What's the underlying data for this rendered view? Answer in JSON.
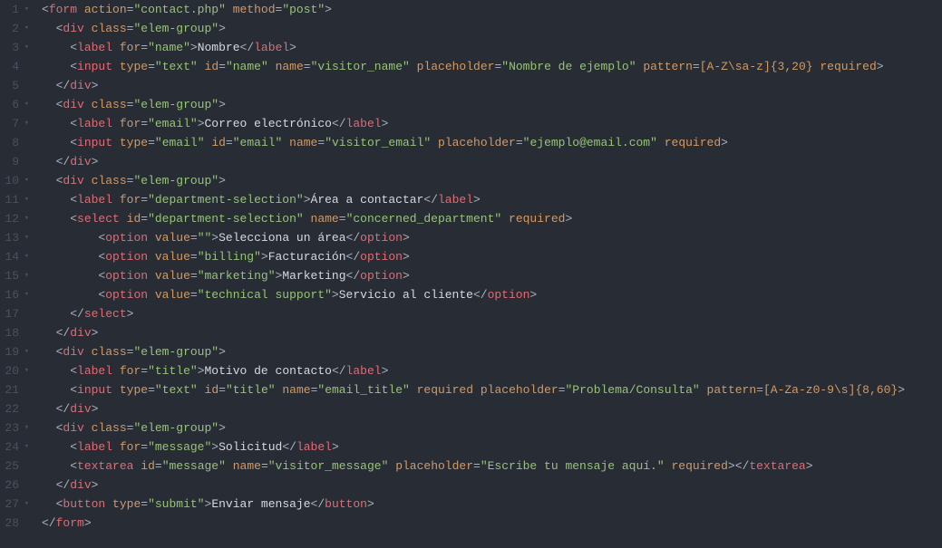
{
  "gutter": [
    {
      "n": "1",
      "fold": true
    },
    {
      "n": "2",
      "fold": true
    },
    {
      "n": "3",
      "fold": true
    },
    {
      "n": "4",
      "fold": false
    },
    {
      "n": "5",
      "fold": false
    },
    {
      "n": "6",
      "fold": true
    },
    {
      "n": "7",
      "fold": true
    },
    {
      "n": "8",
      "fold": false
    },
    {
      "n": "9",
      "fold": false
    },
    {
      "n": "10",
      "fold": true
    },
    {
      "n": "11",
      "fold": true
    },
    {
      "n": "12",
      "fold": true
    },
    {
      "n": "13",
      "fold": true
    },
    {
      "n": "14",
      "fold": true
    },
    {
      "n": "15",
      "fold": true
    },
    {
      "n": "16",
      "fold": true
    },
    {
      "n": "17",
      "fold": false
    },
    {
      "n": "18",
      "fold": false
    },
    {
      "n": "19",
      "fold": true
    },
    {
      "n": "20",
      "fold": true
    },
    {
      "n": "21",
      "fold": false
    },
    {
      "n": "22",
      "fold": false
    },
    {
      "n": "23",
      "fold": true
    },
    {
      "n": "24",
      "fold": true
    },
    {
      "n": "25",
      "fold": false
    },
    {
      "n": "26",
      "fold": false
    },
    {
      "n": "27",
      "fold": true
    },
    {
      "n": "28",
      "fold": false
    }
  ],
  "lines": [
    {
      "indent": 0,
      "tokens": [
        [
          "punct",
          "<"
        ],
        [
          "tag",
          "form"
        ],
        [
          "plain",
          " "
        ],
        [
          "attr",
          "action"
        ],
        [
          "eq",
          "="
        ],
        [
          "str",
          "\"contact.php\""
        ],
        [
          "plain",
          " "
        ],
        [
          "attr",
          "method"
        ],
        [
          "eq",
          "="
        ],
        [
          "str",
          "\"post\""
        ],
        [
          "punct",
          ">"
        ]
      ]
    },
    {
      "indent": 2,
      "tokens": [
        [
          "punct",
          "<"
        ],
        [
          "tag",
          "div"
        ],
        [
          "plain",
          " "
        ],
        [
          "attr",
          "class"
        ],
        [
          "eq",
          "="
        ],
        [
          "str",
          "\"elem-group\""
        ],
        [
          "punct",
          ">"
        ]
      ]
    },
    {
      "indent": 4,
      "tokens": [
        [
          "punct",
          "<"
        ],
        [
          "tag",
          "label"
        ],
        [
          "plain",
          " "
        ],
        [
          "attr",
          "for"
        ],
        [
          "eq",
          "="
        ],
        [
          "str",
          "\"name\""
        ],
        [
          "punct",
          ">"
        ],
        [
          "text",
          "Nombre"
        ],
        [
          "punct",
          "</"
        ],
        [
          "tag",
          "label"
        ],
        [
          "punct",
          ">"
        ]
      ]
    },
    {
      "indent": 4,
      "tokens": [
        [
          "punct",
          "<"
        ],
        [
          "tag",
          "input"
        ],
        [
          "plain",
          " "
        ],
        [
          "attr",
          "type"
        ],
        [
          "eq",
          "="
        ],
        [
          "str",
          "\"text\""
        ],
        [
          "plain",
          " "
        ],
        [
          "attr",
          "id"
        ],
        [
          "eq",
          "="
        ],
        [
          "str",
          "\"name\""
        ],
        [
          "plain",
          " "
        ],
        [
          "attr",
          "name"
        ],
        [
          "eq",
          "="
        ],
        [
          "str",
          "\"visitor_name\""
        ],
        [
          "plain",
          " "
        ],
        [
          "attr",
          "placeholder"
        ],
        [
          "eq",
          "="
        ],
        [
          "str",
          "\"Nombre de ejemplo\""
        ],
        [
          "plain",
          " "
        ],
        [
          "attr",
          "pattern"
        ],
        [
          "eq",
          "="
        ],
        [
          "attr",
          "[A-Z\\sa-z]{3,20}"
        ],
        [
          "plain",
          " "
        ],
        [
          "attr",
          "required"
        ],
        [
          "punct",
          ">"
        ]
      ]
    },
    {
      "indent": 2,
      "tokens": [
        [
          "punct",
          "</"
        ],
        [
          "tag",
          "div"
        ],
        [
          "punct",
          ">"
        ]
      ]
    },
    {
      "indent": 2,
      "tokens": [
        [
          "punct",
          "<"
        ],
        [
          "tag",
          "div"
        ],
        [
          "plain",
          " "
        ],
        [
          "attr",
          "class"
        ],
        [
          "eq",
          "="
        ],
        [
          "str",
          "\"elem-group\""
        ],
        [
          "punct",
          ">"
        ]
      ]
    },
    {
      "indent": 4,
      "tokens": [
        [
          "punct",
          "<"
        ],
        [
          "tag",
          "label"
        ],
        [
          "plain",
          " "
        ],
        [
          "attr",
          "for"
        ],
        [
          "eq",
          "="
        ],
        [
          "str",
          "\"email\""
        ],
        [
          "punct",
          ">"
        ],
        [
          "text",
          "Correo electrónico"
        ],
        [
          "punct",
          "</"
        ],
        [
          "tag",
          "label"
        ],
        [
          "punct",
          ">"
        ]
      ]
    },
    {
      "indent": 4,
      "tokens": [
        [
          "punct",
          "<"
        ],
        [
          "tag",
          "input"
        ],
        [
          "plain",
          " "
        ],
        [
          "attr",
          "type"
        ],
        [
          "eq",
          "="
        ],
        [
          "str",
          "\"email\""
        ],
        [
          "plain",
          " "
        ],
        [
          "attr",
          "id"
        ],
        [
          "eq",
          "="
        ],
        [
          "str",
          "\"email\""
        ],
        [
          "plain",
          " "
        ],
        [
          "attr",
          "name"
        ],
        [
          "eq",
          "="
        ],
        [
          "str",
          "\"visitor_email\""
        ],
        [
          "plain",
          " "
        ],
        [
          "attr",
          "placeholder"
        ],
        [
          "eq",
          "="
        ],
        [
          "str",
          "\"ejemplo@email.com\""
        ],
        [
          "plain",
          " "
        ],
        [
          "attr",
          "required"
        ],
        [
          "punct",
          ">"
        ]
      ]
    },
    {
      "indent": 2,
      "tokens": [
        [
          "punct",
          "</"
        ],
        [
          "tag",
          "div"
        ],
        [
          "punct",
          ">"
        ]
      ]
    },
    {
      "indent": 2,
      "tokens": [
        [
          "punct",
          "<"
        ],
        [
          "tag",
          "div"
        ],
        [
          "plain",
          " "
        ],
        [
          "attr",
          "class"
        ],
        [
          "eq",
          "="
        ],
        [
          "str",
          "\"elem-group\""
        ],
        [
          "punct",
          ">"
        ]
      ]
    },
    {
      "indent": 4,
      "tokens": [
        [
          "punct",
          "<"
        ],
        [
          "tag",
          "label"
        ],
        [
          "plain",
          " "
        ],
        [
          "attr",
          "for"
        ],
        [
          "eq",
          "="
        ],
        [
          "str",
          "\"department-selection\""
        ],
        [
          "punct",
          ">"
        ],
        [
          "text",
          "Área a contactar"
        ],
        [
          "punct",
          "</"
        ],
        [
          "tag",
          "label"
        ],
        [
          "punct",
          ">"
        ]
      ]
    },
    {
      "indent": 4,
      "tokens": [
        [
          "punct",
          "<"
        ],
        [
          "tag",
          "select"
        ],
        [
          "plain",
          " "
        ],
        [
          "attr",
          "id"
        ],
        [
          "eq",
          "="
        ],
        [
          "str",
          "\"department-selection\""
        ],
        [
          "plain",
          " "
        ],
        [
          "attr",
          "name"
        ],
        [
          "eq",
          "="
        ],
        [
          "str",
          "\"concerned_department\""
        ],
        [
          "plain",
          " "
        ],
        [
          "attr",
          "required"
        ],
        [
          "punct",
          ">"
        ]
      ]
    },
    {
      "indent": 8,
      "tokens": [
        [
          "punct",
          "<"
        ],
        [
          "tag",
          "option"
        ],
        [
          "plain",
          " "
        ],
        [
          "attr",
          "value"
        ],
        [
          "eq",
          "="
        ],
        [
          "str",
          "\"\""
        ],
        [
          "punct",
          ">"
        ],
        [
          "text",
          "Selecciona un área"
        ],
        [
          "punct",
          "</"
        ],
        [
          "tag",
          "option"
        ],
        [
          "punct",
          ">"
        ]
      ]
    },
    {
      "indent": 8,
      "tokens": [
        [
          "punct",
          "<"
        ],
        [
          "tag",
          "option"
        ],
        [
          "plain",
          " "
        ],
        [
          "attr",
          "value"
        ],
        [
          "eq",
          "="
        ],
        [
          "str",
          "\"billing\""
        ],
        [
          "punct",
          ">"
        ],
        [
          "text",
          "Facturación"
        ],
        [
          "punct",
          "</"
        ],
        [
          "tag",
          "option"
        ],
        [
          "punct",
          ">"
        ]
      ]
    },
    {
      "indent": 8,
      "tokens": [
        [
          "punct",
          "<"
        ],
        [
          "tag",
          "option"
        ],
        [
          "plain",
          " "
        ],
        [
          "attr",
          "value"
        ],
        [
          "eq",
          "="
        ],
        [
          "str",
          "\"marketing\""
        ],
        [
          "punct",
          ">"
        ],
        [
          "text",
          "Marketing"
        ],
        [
          "punct",
          "</"
        ],
        [
          "tag",
          "option"
        ],
        [
          "punct",
          ">"
        ]
      ]
    },
    {
      "indent": 8,
      "tokens": [
        [
          "punct",
          "<"
        ],
        [
          "tag",
          "option"
        ],
        [
          "plain",
          " "
        ],
        [
          "attr",
          "value"
        ],
        [
          "eq",
          "="
        ],
        [
          "str",
          "\"technical support\""
        ],
        [
          "punct",
          ">"
        ],
        [
          "text",
          "Servicio al cliente"
        ],
        [
          "punct",
          "</"
        ],
        [
          "tag",
          "option"
        ],
        [
          "punct",
          ">"
        ]
      ]
    },
    {
      "indent": 4,
      "tokens": [
        [
          "punct",
          "</"
        ],
        [
          "tag",
          "select"
        ],
        [
          "punct",
          ">"
        ]
      ]
    },
    {
      "indent": 2,
      "tokens": [
        [
          "punct",
          "</"
        ],
        [
          "tag",
          "div"
        ],
        [
          "punct",
          ">"
        ]
      ]
    },
    {
      "indent": 2,
      "tokens": [
        [
          "punct",
          "<"
        ],
        [
          "tag",
          "div"
        ],
        [
          "plain",
          " "
        ],
        [
          "attr",
          "class"
        ],
        [
          "eq",
          "="
        ],
        [
          "str",
          "\"elem-group\""
        ],
        [
          "punct",
          ">"
        ]
      ]
    },
    {
      "indent": 4,
      "tokens": [
        [
          "punct",
          "<"
        ],
        [
          "tag",
          "label"
        ],
        [
          "plain",
          " "
        ],
        [
          "attr",
          "for"
        ],
        [
          "eq",
          "="
        ],
        [
          "str",
          "\"title\""
        ],
        [
          "punct",
          ">"
        ],
        [
          "text",
          "Motivo de contacto"
        ],
        [
          "punct",
          "</"
        ],
        [
          "tag",
          "label"
        ],
        [
          "punct",
          ">"
        ]
      ]
    },
    {
      "indent": 4,
      "tokens": [
        [
          "punct",
          "<"
        ],
        [
          "tag",
          "input"
        ],
        [
          "plain",
          " "
        ],
        [
          "attr",
          "type"
        ],
        [
          "eq",
          "="
        ],
        [
          "str",
          "\"text\""
        ],
        [
          "plain",
          " "
        ],
        [
          "attr",
          "id"
        ],
        [
          "eq",
          "="
        ],
        [
          "str",
          "\"title\""
        ],
        [
          "plain",
          " "
        ],
        [
          "attr",
          "name"
        ],
        [
          "eq",
          "="
        ],
        [
          "str",
          "\"email_title\""
        ],
        [
          "plain",
          " "
        ],
        [
          "attr",
          "required"
        ],
        [
          "plain",
          " "
        ],
        [
          "attr",
          "placeholder"
        ],
        [
          "eq",
          "="
        ],
        [
          "str",
          "\"Problema/Consulta\""
        ],
        [
          "plain",
          " "
        ],
        [
          "attr",
          "pattern"
        ],
        [
          "eq",
          "="
        ],
        [
          "attr",
          "[A-Za-z0-9\\s]{8,60}"
        ],
        [
          "punct",
          ">"
        ]
      ]
    },
    {
      "indent": 2,
      "tokens": [
        [
          "punct",
          "</"
        ],
        [
          "tag",
          "div"
        ],
        [
          "punct",
          ">"
        ]
      ]
    },
    {
      "indent": 2,
      "tokens": [
        [
          "punct",
          "<"
        ],
        [
          "tag",
          "div"
        ],
        [
          "plain",
          " "
        ],
        [
          "attr",
          "class"
        ],
        [
          "eq",
          "="
        ],
        [
          "str",
          "\"elem-group\""
        ],
        [
          "punct",
          ">"
        ]
      ]
    },
    {
      "indent": 4,
      "tokens": [
        [
          "punct",
          "<"
        ],
        [
          "tag",
          "label"
        ],
        [
          "plain",
          " "
        ],
        [
          "attr",
          "for"
        ],
        [
          "eq",
          "="
        ],
        [
          "str",
          "\"message\""
        ],
        [
          "punct",
          ">"
        ],
        [
          "text",
          "Solicitud"
        ],
        [
          "punct",
          "</"
        ],
        [
          "tag",
          "label"
        ],
        [
          "punct",
          ">"
        ]
      ]
    },
    {
      "indent": 4,
      "tokens": [
        [
          "punct",
          "<"
        ],
        [
          "tag",
          "textarea"
        ],
        [
          "plain",
          " "
        ],
        [
          "attr",
          "id"
        ],
        [
          "eq",
          "="
        ],
        [
          "str",
          "\"message\""
        ],
        [
          "plain",
          " "
        ],
        [
          "attr",
          "name"
        ],
        [
          "eq",
          "="
        ],
        [
          "str",
          "\"visitor_message\""
        ],
        [
          "plain",
          " "
        ],
        [
          "attr",
          "placeholder"
        ],
        [
          "eq",
          "="
        ],
        [
          "str",
          "\"Escribe tu mensaje aquí.\""
        ],
        [
          "plain",
          " "
        ],
        [
          "attr",
          "required"
        ],
        [
          "punct",
          ">"
        ],
        [
          "punct",
          "</"
        ],
        [
          "tag",
          "textarea"
        ],
        [
          "punct",
          ">"
        ]
      ]
    },
    {
      "indent": 2,
      "tokens": [
        [
          "punct",
          "</"
        ],
        [
          "tag",
          "div"
        ],
        [
          "punct",
          ">"
        ]
      ]
    },
    {
      "indent": 2,
      "tokens": [
        [
          "punct",
          "<"
        ],
        [
          "tag",
          "button"
        ],
        [
          "plain",
          " "
        ],
        [
          "attr",
          "type"
        ],
        [
          "eq",
          "="
        ],
        [
          "str",
          "\"submit\""
        ],
        [
          "punct",
          ">"
        ],
        [
          "text",
          "Enviar mensaje"
        ],
        [
          "punct",
          "</"
        ],
        [
          "tag",
          "button"
        ],
        [
          "punct",
          ">"
        ]
      ]
    },
    {
      "indent": 0,
      "tokens": [
        [
          "punct",
          "</"
        ],
        [
          "tag",
          "form"
        ],
        [
          "punct",
          ">"
        ]
      ]
    }
  ]
}
